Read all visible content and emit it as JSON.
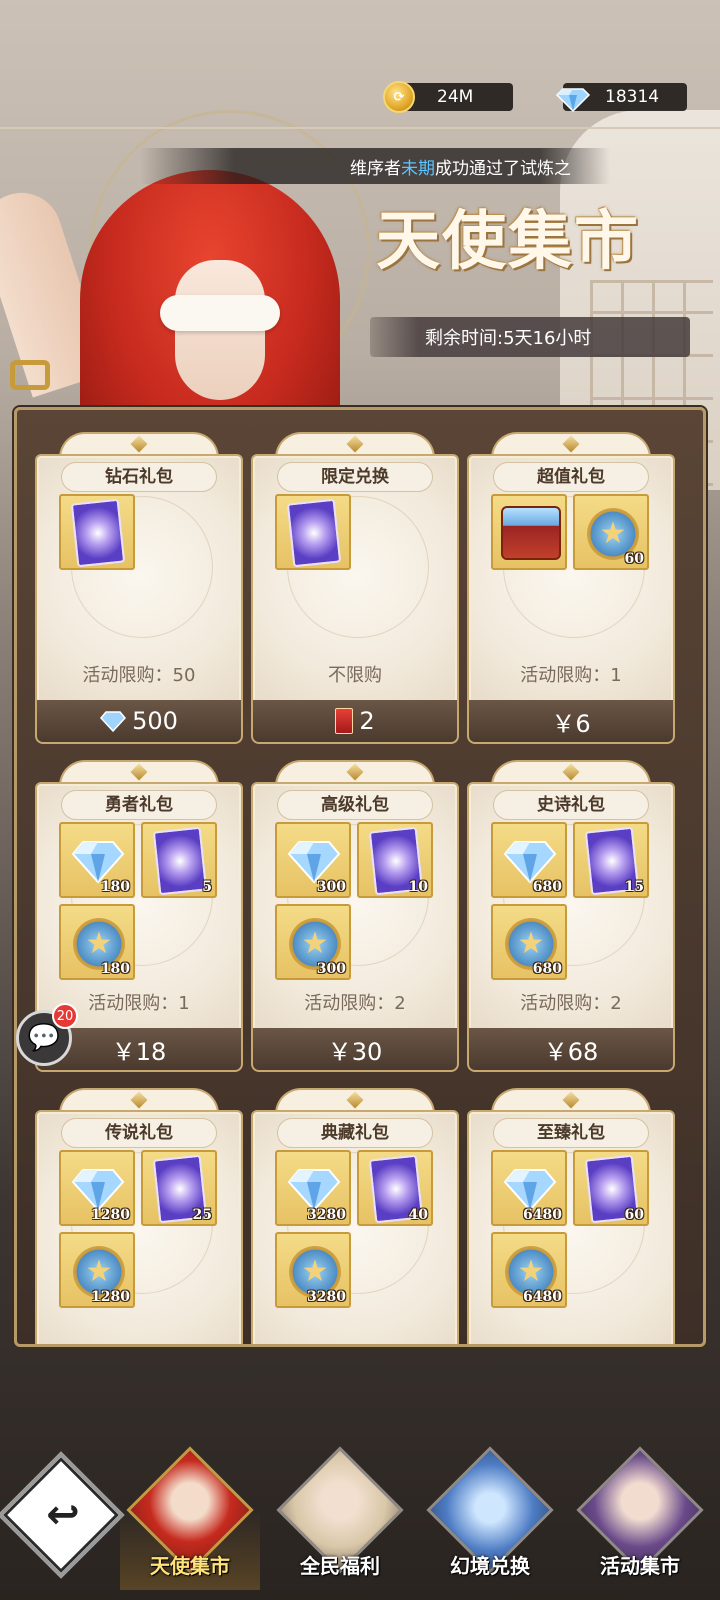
{
  "resources": {
    "gold": "24M",
    "diamonds": "18314"
  },
  "marquee": {
    "prefix": "维序者",
    "name": "未期",
    "suffix": "成功通过了试炼之"
  },
  "title": "天使集市",
  "timer": "剩余时间:5天16小时",
  "cards": [
    {
      "name": "钻石礼包",
      "limit": "活动限购：50",
      "price": "500",
      "price_type": "diamond",
      "items": [
        {
          "type": "card",
          "count": ""
        }
      ]
    },
    {
      "name": "限定兑换",
      "limit": "不限购",
      "price": "2",
      "price_type": "ticket",
      "items": [
        {
          "type": "card",
          "count": ""
        }
      ]
    },
    {
      "name": "超值礼包",
      "limit": "活动限购：1",
      "price": "￥6",
      "price_type": "cash",
      "items": [
        {
          "type": "chest",
          "count": ""
        },
        {
          "type": "star",
          "count": "60"
        }
      ]
    },
    {
      "name": "勇者礼包",
      "limit": "活动限购：1",
      "price": "￥18",
      "price_type": "cash",
      "items": [
        {
          "type": "gem",
          "count": "180"
        },
        {
          "type": "card",
          "count": "5"
        },
        {
          "type": "star",
          "count": "180"
        }
      ]
    },
    {
      "name": "高级礼包",
      "limit": "活动限购：2",
      "price": "￥30",
      "price_type": "cash",
      "items": [
        {
          "type": "gem",
          "count": "300"
        },
        {
          "type": "card",
          "count": "10"
        },
        {
          "type": "star",
          "count": "300"
        }
      ]
    },
    {
      "name": "史诗礼包",
      "limit": "活动限购：2",
      "price": "￥68",
      "price_type": "cash",
      "items": [
        {
          "type": "gem",
          "count": "680"
        },
        {
          "type": "card",
          "count": "15"
        },
        {
          "type": "star",
          "count": "680"
        }
      ]
    },
    {
      "name": "传说礼包",
      "limit": "",
      "price": "",
      "price_type": "cash",
      "items": [
        {
          "type": "gem",
          "count": "1280"
        },
        {
          "type": "card",
          "count": "25"
        },
        {
          "type": "star",
          "count": "1280"
        }
      ]
    },
    {
      "name": "典藏礼包",
      "limit": "",
      "price": "",
      "price_type": "cash",
      "items": [
        {
          "type": "gem",
          "count": "3280"
        },
        {
          "type": "card",
          "count": "40"
        },
        {
          "type": "star",
          "count": "3280"
        }
      ]
    },
    {
      "name": "至臻礼包",
      "limit": "",
      "price": "",
      "price_type": "cash",
      "items": [
        {
          "type": "gem",
          "count": "6480"
        },
        {
          "type": "card",
          "count": "60"
        },
        {
          "type": "star",
          "count": "6480"
        }
      ]
    }
  ],
  "chat": {
    "badge": "20",
    "icon": "chat-bubble-icon"
  },
  "nav": {
    "back_icon": "back-arrow-icon",
    "tabs": [
      {
        "label": "天使集市",
        "active": true,
        "color": "#c62a1e"
      },
      {
        "label": "全民福利",
        "active": false,
        "color": "#d9c7a8"
      },
      {
        "label": "幻境兑换",
        "active": false,
        "color": "#4d7cc4"
      },
      {
        "label": "活动集市",
        "active": false,
        "color": "#6a4a8a"
      }
    ]
  },
  "colors": {
    "accent": "#c8a871",
    "panel": "#4a3a2e",
    "highlight": "#5ec4ff",
    "active_tab": "#ffe27a"
  }
}
